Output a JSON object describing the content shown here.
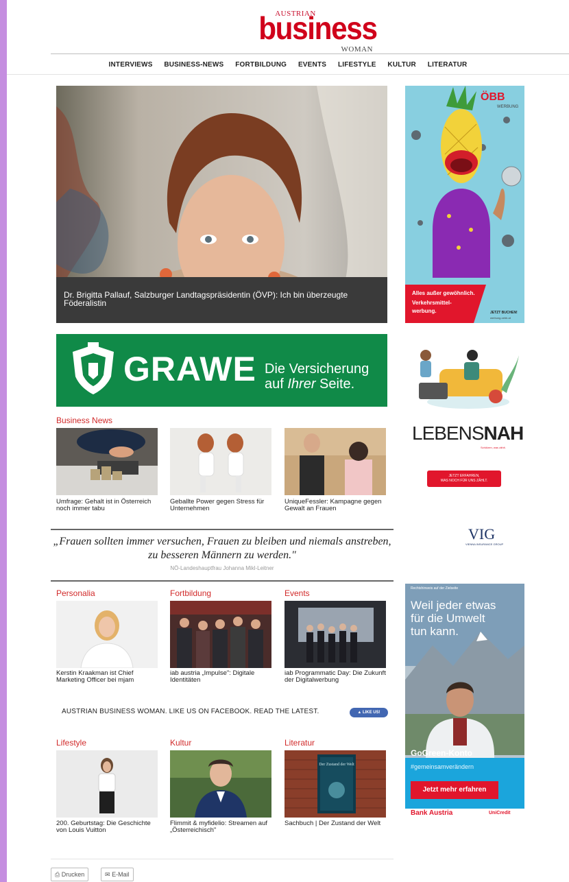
{
  "logo": {
    "top": "AUSTRIAN",
    "main": "business",
    "bottom": "WOMAN"
  },
  "nav": [
    "INTERVIEWS",
    "BUSINESS-NEWS",
    "FORTBILDUNG",
    "EVENTS",
    "LIFESTYLE",
    "KULTUR",
    "LITERATUR"
  ],
  "hero": {
    "caption": "Dr. Brigitta Pallauf, Salzburger Landtagspräsidentin (ÖVP): Ich bin überzeugte Föderalistin"
  },
  "grawe": {
    "brand": "GRAWE",
    "line1": "Die Versicherung",
    "line2_a": "auf ",
    "line2_b": "Ihrer",
    "line2_c": " Seite."
  },
  "business_news": {
    "title": "Business News",
    "items": [
      {
        "caption": "Umfrage: Gehalt ist in Österreich noch immer tabu"
      },
      {
        "caption": "Geballte Power gegen Stress für Unternehmen"
      },
      {
        "caption": "UniqueFessler: Kampagne gegen Gewalt an Frauen"
      }
    ]
  },
  "quote": {
    "text": "„Frauen sollten immer versuchen, Frauen zu bleiben und niemals anstreben, zu besseren Männern zu werden.\"",
    "source": "NÖ-Landeshauptfrau Johanna Mikl-Leitner"
  },
  "sections_row1": [
    {
      "title": "Personalia",
      "caption": "Kerstin Kraakman ist Chief Marketing Officer bei mjam"
    },
    {
      "title": "Fortbildung",
      "caption": "iab austria „Impulse\": Digitale Identitäten"
    },
    {
      "title": "Events",
      "caption": "iab Programmatic Day: Die Zukunft der Digitalwerbung"
    }
  ],
  "facebook": {
    "text": "AUSTRIAN BUSINESS WOMAN. LIKE US ON FACEBOOK. READ THE LATEST.",
    "button": "LIKE US!"
  },
  "sections_row2": [
    {
      "title": "Lifestyle",
      "caption": "200. Geburtstag: Die Geschichte von Louis Vuitton"
    },
    {
      "title": "Kultur",
      "caption": "Flimmit & myfidelio: Streamen auf „Österreichisch\""
    },
    {
      "title": "Literatur",
      "caption": "Sachbuch | Der Zustand der Welt"
    }
  ],
  "book_title": "Der Zustand der Welt",
  "actions": {
    "print": "Drucken",
    "email": "E-Mail"
  },
  "ads": {
    "obb": {
      "brand": "ÖBB",
      "sub": "WERBUNG",
      "tag1": "Alles außer gewöhnlich.",
      "tag2": "Verkehrsmittel-",
      "tag3": "werbung.",
      "cta": "JETZT BUCHEN!",
      "url": "werbung.oebb.at"
    },
    "vig": {
      "brand_a": "LEBENS",
      "brand_b": "NAH",
      "sub": "Schützen, was zählt.",
      "btn1": "JETZT ERFAHREN,",
      "btn2": "WAS NOCH FÜR UNS ZÄHLT.",
      "logo": "VIG",
      "logo_sub": "VIENNA INSURANCE GROUP"
    },
    "bank": {
      "legal": "Rechtshinweis auf der Zielseite",
      "headline1": "Weil jeder etwas",
      "headline2": "für die Umwelt",
      "headline3": "tun kann.",
      "product": "GoGreen-Konto",
      "hashtag": "#gemeinsamverändern",
      "cta": "Jetzt mehr erfahren",
      "brand": "Bank Austria",
      "group": "UniCredit"
    }
  }
}
